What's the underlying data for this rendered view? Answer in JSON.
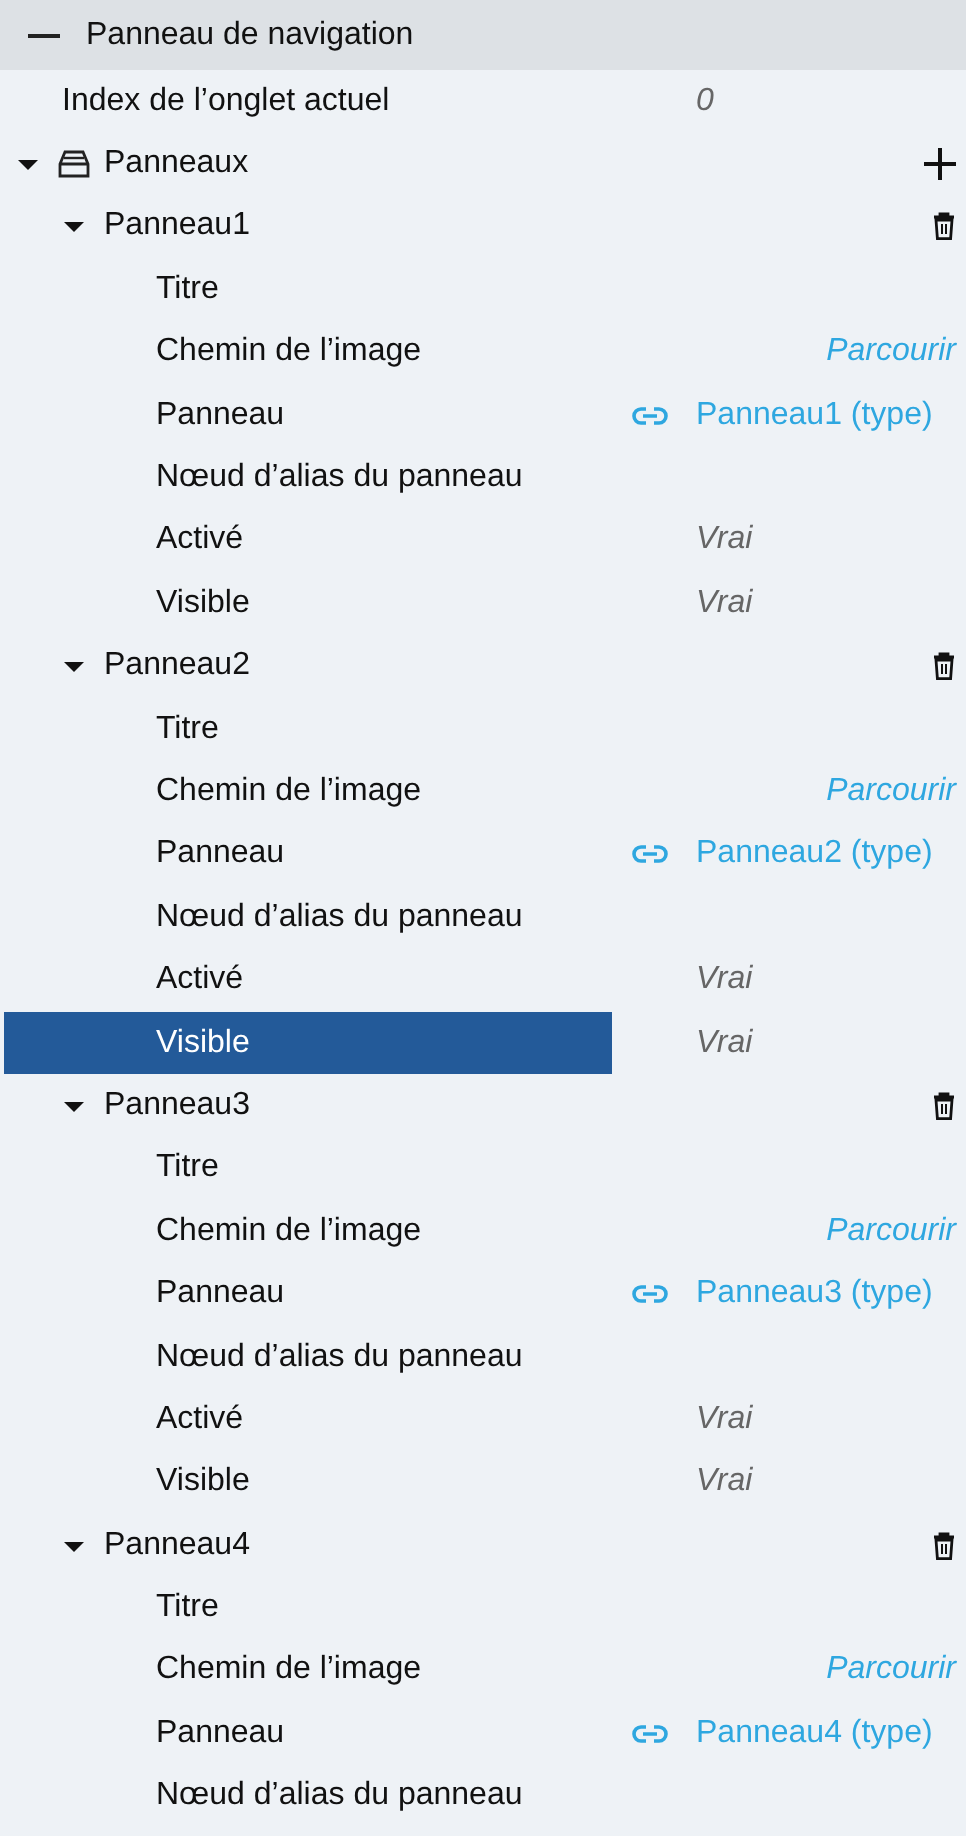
{
  "section": {
    "title": "Panneau de navigation",
    "expanded": true
  },
  "index_row": {
    "label": "Index de l’onglet actuel",
    "value": "0"
  },
  "collection": {
    "label": "Panneaux",
    "expanded": true,
    "items": [
      {
        "label": "Panneau1",
        "expanded": true,
        "properties": [
          {
            "kind": "plain",
            "label": "Titre",
            "selected": false
          },
          {
            "kind": "browse",
            "label": "Chemin de l’image",
            "value": "Parcourir",
            "selected": false
          },
          {
            "kind": "reference",
            "label": "Panneau",
            "value": "Panneau1 (type)",
            "selected": false
          },
          {
            "kind": "plain",
            "label": "Nœud d’alias du panneau",
            "selected": false
          },
          {
            "kind": "value",
            "label": "Activé",
            "value": "Vrai",
            "selected": false
          },
          {
            "kind": "value",
            "label": "Visible",
            "value": "Vrai",
            "selected": false
          }
        ]
      },
      {
        "label": "Panneau2",
        "expanded": true,
        "properties": [
          {
            "kind": "plain",
            "label": "Titre",
            "selected": false
          },
          {
            "kind": "browse",
            "label": "Chemin de l’image",
            "value": "Parcourir",
            "selected": false
          },
          {
            "kind": "reference",
            "label": "Panneau",
            "value": "Panneau2 (type)",
            "selected": false
          },
          {
            "kind": "plain",
            "label": "Nœud d’alias du panneau",
            "selected": false
          },
          {
            "kind": "value",
            "label": "Activé",
            "value": "Vrai",
            "selected": false
          },
          {
            "kind": "value",
            "label": "Visible",
            "value": "Vrai",
            "selected": true
          }
        ]
      },
      {
        "label": "Panneau3",
        "expanded": true,
        "properties": [
          {
            "kind": "plain",
            "label": "Titre",
            "selected": false
          },
          {
            "kind": "browse",
            "label": "Chemin de l’image",
            "value": "Parcourir",
            "selected": false
          },
          {
            "kind": "reference",
            "label": "Panneau",
            "value": "Panneau3 (type)",
            "selected": false
          },
          {
            "kind": "plain",
            "label": "Nœud d’alias du panneau",
            "selected": false
          },
          {
            "kind": "value",
            "label": "Activé",
            "value": "Vrai",
            "selected": false
          },
          {
            "kind": "value",
            "label": "Visible",
            "value": "Vrai",
            "selected": false
          }
        ]
      },
      {
        "label": "Panneau4",
        "expanded": true,
        "properties": [
          {
            "kind": "plain",
            "label": "Titre",
            "selected": false
          },
          {
            "kind": "browse",
            "label": "Chemin de l’image",
            "value": "Parcourir",
            "selected": false
          },
          {
            "kind": "reference",
            "label": "Panneau",
            "value": "Panneau4 (type)",
            "selected": false
          },
          {
            "kind": "plain",
            "label": "Nœud d’alias du panneau",
            "selected": false
          }
        ]
      }
    ]
  }
}
